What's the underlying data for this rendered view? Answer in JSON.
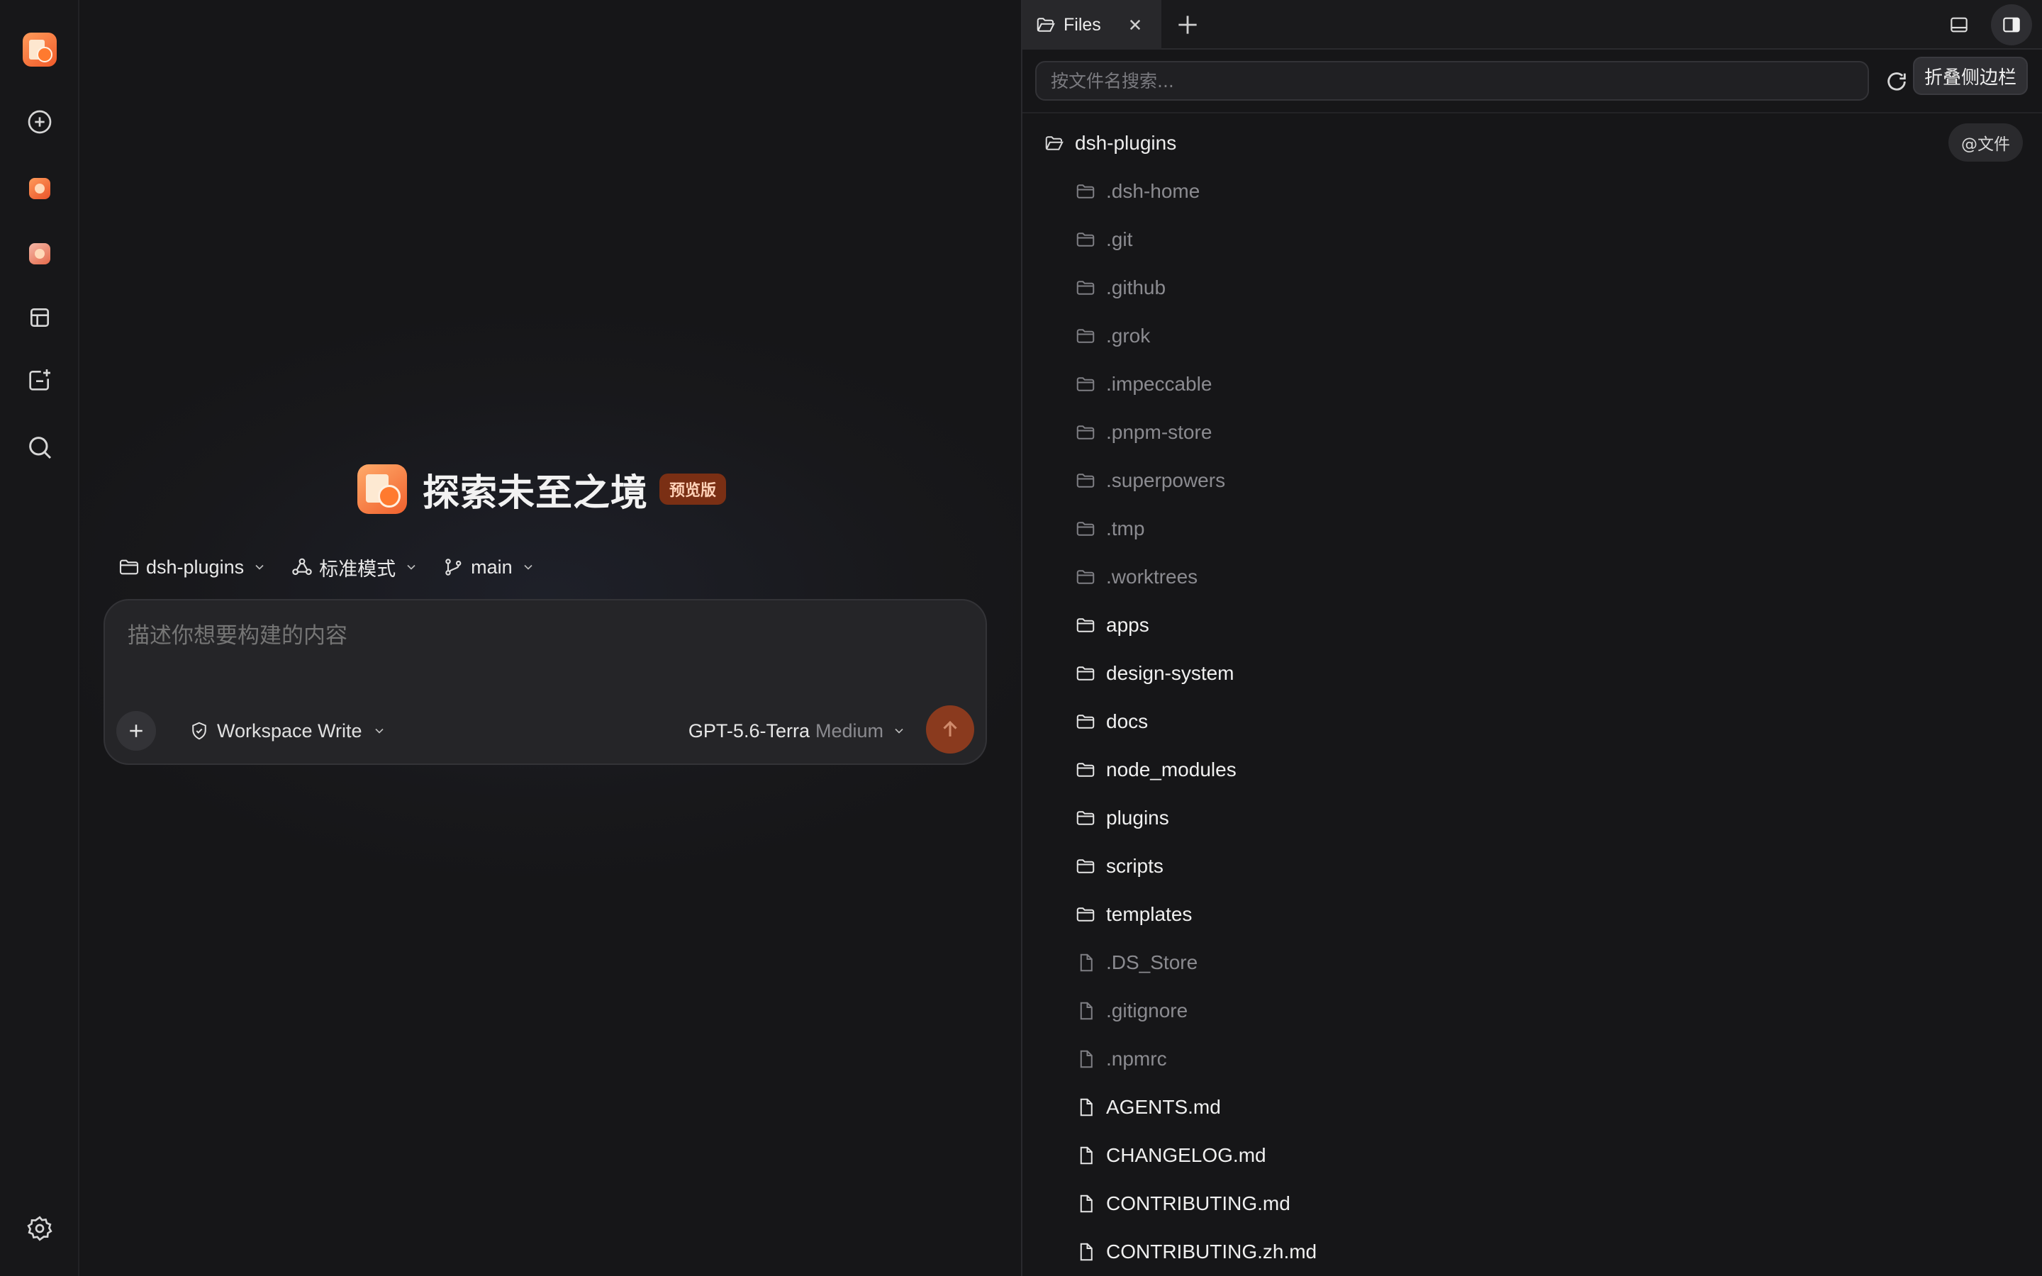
{
  "rail": {
    "items": [
      {
        "name": "app-logo",
        "icon": "app-logo-icon"
      },
      {
        "name": "new-session",
        "icon": "plus-circle-icon"
      },
      {
        "name": "agent-a",
        "icon": "agent-avatar-icon"
      },
      {
        "name": "agent-b",
        "icon": "agent-avatar-icon"
      },
      {
        "name": "layout",
        "icon": "layout-icon"
      },
      {
        "name": "add-app",
        "icon": "add-window-icon"
      },
      {
        "name": "search",
        "icon": "search-icon"
      },
      {
        "name": "settings",
        "icon": "gear-icon"
      }
    ]
  },
  "hero": {
    "title": "探索未至之境",
    "badge": "预览版"
  },
  "context": {
    "project": "dsh-plugins",
    "mode": "标准模式",
    "branch": "main"
  },
  "composer": {
    "placeholder": "描述你想要构建的内容",
    "permission": "Workspace Write",
    "model": "GPT-5.6-Terra",
    "effort": "Medium"
  },
  "right_panel": {
    "tab_label": "Files",
    "search_placeholder": "按文件名搜索...",
    "tooltip": "折叠侧边栏",
    "mention_label": "@文件",
    "root": "dsh-plugins",
    "entries": [
      {
        "name": ".dsh-home",
        "type": "folder",
        "dim": true
      },
      {
        "name": ".git",
        "type": "folder",
        "dim": true
      },
      {
        "name": ".github",
        "type": "folder",
        "dim": true
      },
      {
        "name": ".grok",
        "type": "folder",
        "dim": true
      },
      {
        "name": ".impeccable",
        "type": "folder",
        "dim": true
      },
      {
        "name": ".pnpm-store",
        "type": "folder",
        "dim": true
      },
      {
        "name": ".superpowers",
        "type": "folder",
        "dim": true
      },
      {
        "name": ".tmp",
        "type": "folder",
        "dim": true
      },
      {
        "name": ".worktrees",
        "type": "folder",
        "dim": true
      },
      {
        "name": "apps",
        "type": "folder",
        "dim": false
      },
      {
        "name": "design-system",
        "type": "folder",
        "dim": false
      },
      {
        "name": "docs",
        "type": "folder",
        "dim": false
      },
      {
        "name": "node_modules",
        "type": "folder",
        "dim": false
      },
      {
        "name": "plugins",
        "type": "folder",
        "dim": false
      },
      {
        "name": "scripts",
        "type": "folder",
        "dim": false
      },
      {
        "name": "templates",
        "type": "folder",
        "dim": false
      },
      {
        "name": ".DS_Store",
        "type": "file",
        "dim": true
      },
      {
        "name": ".gitignore",
        "type": "file",
        "dim": true
      },
      {
        "name": ".npmrc",
        "type": "file",
        "dim": true
      },
      {
        "name": "AGENTS.md",
        "type": "file",
        "dim": false
      },
      {
        "name": "CHANGELOG.md",
        "type": "file",
        "dim": false
      },
      {
        "name": "CONTRIBUTING.md",
        "type": "file",
        "dim": false
      },
      {
        "name": "CONTRIBUTING.zh.md",
        "type": "file",
        "dim": false
      }
    ]
  },
  "colors": {
    "accent": "#f0602d",
    "send_button": "#8a3a1e",
    "badge_bg": "#7a2f14"
  }
}
